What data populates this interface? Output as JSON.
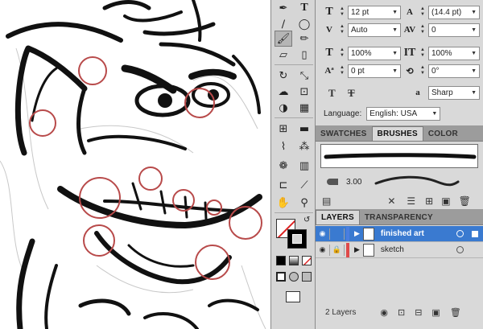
{
  "character_panel": {
    "font_size": "12 pt",
    "leading": "(14.4 pt)",
    "kerning": "Auto",
    "tracking": "0",
    "vertical_scale": "100%",
    "horizontal_scale": "100%",
    "baseline_shift": "0 pt",
    "character_rotation": "0°",
    "aa_label": "a",
    "anti_aliasing": "Sharp",
    "language_label": "Language:",
    "language": "English: USA",
    "tt_label": "T",
    "tt_strike_label": "T",
    "icons": [
      "font-size-icon",
      "leading-icon",
      "kerning-icon",
      "tracking-icon",
      "vertical-scale-icon",
      "horizontal-scale-icon",
      "baseline-shift-icon",
      "rotation-icon"
    ]
  },
  "swatch_tabs": [
    {
      "label": "SWATCHES",
      "active": false
    },
    {
      "label": "BRUSHES",
      "active": true
    },
    {
      "label": "COLOR",
      "active": false
    }
  ],
  "brushes": {
    "size_value": "3.00"
  },
  "layers_tabs": [
    {
      "label": "LAYERS",
      "active": true
    },
    {
      "label": "TRANSPARENCY",
      "active": false
    }
  ],
  "layers": [
    {
      "name": "finished art",
      "selected": true,
      "color": "#4a7ee0"
    },
    {
      "name": "sketch",
      "selected": false,
      "color": "#e04a4a"
    }
  ],
  "layers_footer": {
    "count": "2 Layers"
  },
  "colors": {
    "accent": "#3a7ad0",
    "panel_bg": "#d9d9d9",
    "tab_bar": "#9c9c9c",
    "circle_annotation": "#b84a4a"
  },
  "tools": [
    "pen-tool-icon",
    "text-tool-icon",
    "line-tool-icon",
    "ellipse-tool-icon",
    "paintbrush-tool-icon",
    "pencil-tool-icon",
    "eraser-tool-icon",
    "marker-tool-icon",
    "rotate-tool-icon",
    "scale-tool-icon",
    "warp-tool-icon",
    "free-transform-icon",
    "shape-builder-icon",
    "perspective-grid-icon",
    "mesh-tool-icon",
    "gradient-tool-icon",
    "eyedropper-tool-icon",
    "blend-tool-icon",
    "symbol-sprayer-icon",
    "graph-tool-icon",
    "artboard-tool-icon",
    "slice-tool-icon",
    "hand-tool-icon",
    "zoom-tool-icon"
  ]
}
